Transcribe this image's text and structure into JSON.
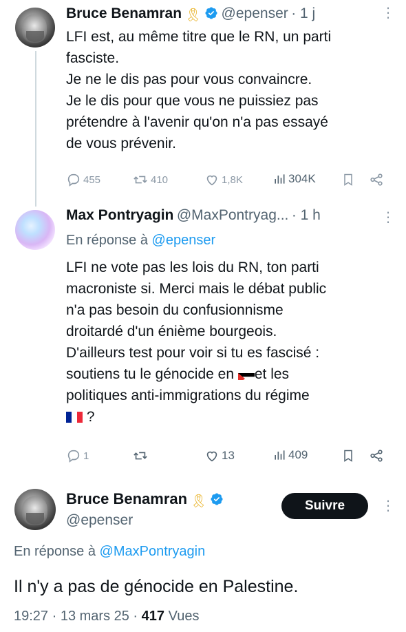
{
  "tweet1": {
    "author": "Bruce Benamran",
    "ribbon": "🎗",
    "handle": "@epenser",
    "time": "· 1 j",
    "lines": [
      "LFI est, au même titre que le RN, un parti",
      "fasciste.",
      "Je ne le dis pas pour vous convaincre.",
      "Je le dis pour que vous ne puissiez pas",
      "prétendre à l'avenir qu'on n'a pas essayé",
      "de vous prévenir."
    ],
    "replies": "455",
    "reposts": "410",
    "likes": "1,8K",
    "views": "304K"
  },
  "tweet2": {
    "author": "Max Pontryagin",
    "handle": "@MaxPontryag...",
    "time": "· 1 h",
    "reply_prefix": "En réponse à",
    "reply_handle": "@epenser",
    "lines": [
      "LFI ne vote pas les lois du RN, ton parti",
      "macroniste si. Merci mais le débat public",
      "n'a pas besoin du confusionnisme",
      "droitardé d'un énième bourgeois.",
      "D'ailleurs test pour voir si tu es fascisé :"
    ],
    "line6_a": "soutiens tu le génocide en",
    "line6_b": "et les",
    "line7": "politiques anti-immigrations du régime",
    "line8": "?",
    "replies": "1",
    "reposts": "",
    "likes": "13",
    "views": "409"
  },
  "tweet3": {
    "author": "Bruce Benamran",
    "ribbon": "🎗",
    "handle": "@epenser",
    "follow_label": "Suivre",
    "reply_prefix": "En réponse à",
    "reply_handle": "@MaxPontryagin",
    "text": "Il n'y a pas de génocide en Palestine.",
    "timestamp": "19:27 · 13 mars 25 ·",
    "views_count": "417",
    "views_label": "Vues"
  },
  "colors": {
    "accent": "#1d9bf0",
    "verified": "#1d9bf0",
    "ribbon": "#e8b020",
    "muted": "#536471",
    "text": "#0f1419"
  }
}
